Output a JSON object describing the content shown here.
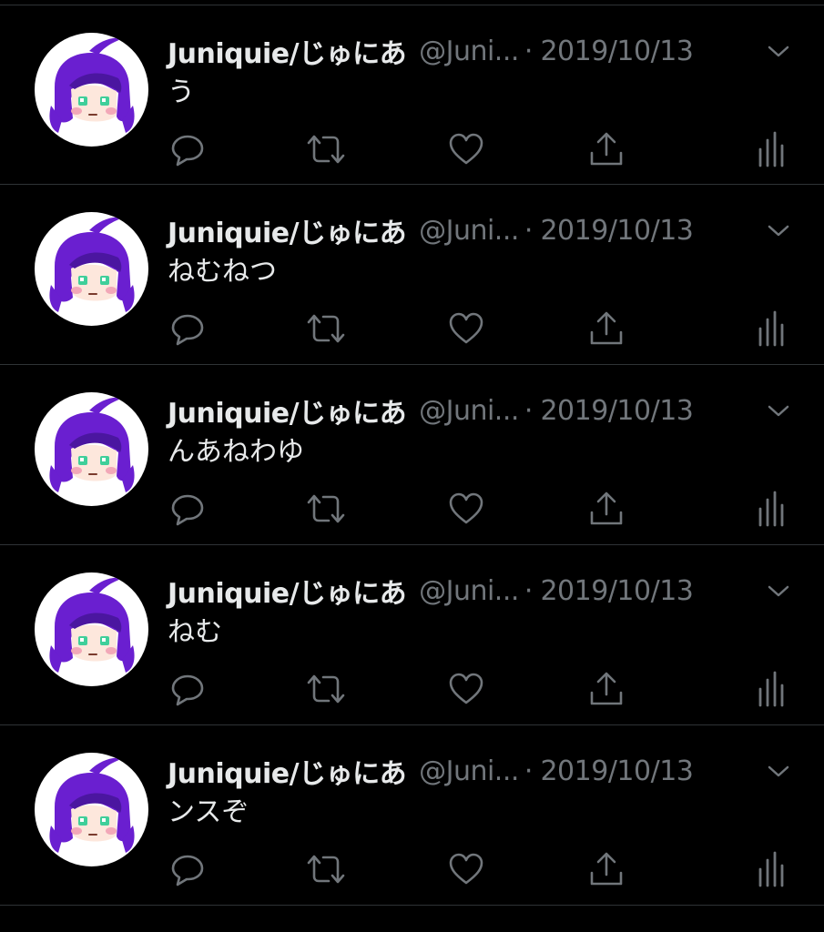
{
  "colors": {
    "background": "#000000",
    "text_primary": "#e7e9ea",
    "text_secondary": "#71767b",
    "divider": "#2f3336",
    "avatar_hair": "#6a1fd0",
    "avatar_eyes": "#3fcf9a"
  },
  "tweets": [
    {
      "display_name": "Juniquie/じゅにあ",
      "handle": "@Juni...",
      "separator": "·",
      "date": "2019/10/13",
      "text": "う",
      "avatar_icon": "purple-hair-girl-avatar",
      "menu_icon": "chevron-down-icon",
      "actions": [
        "reply-icon",
        "retweet-icon",
        "like-icon",
        "share-icon",
        "analytics-icon"
      ]
    },
    {
      "display_name": "Juniquie/じゅにあ",
      "handle": "@Juni...",
      "separator": "·",
      "date": "2019/10/13",
      "text": "ねむねつ",
      "avatar_icon": "purple-hair-girl-avatar",
      "menu_icon": "chevron-down-icon",
      "actions": [
        "reply-icon",
        "retweet-icon",
        "like-icon",
        "share-icon",
        "analytics-icon"
      ]
    },
    {
      "display_name": "Juniquie/じゅにあ",
      "handle": "@Juni...",
      "separator": "·",
      "date": "2019/10/13",
      "text": "んあねわゆ",
      "avatar_icon": "purple-hair-girl-avatar",
      "menu_icon": "chevron-down-icon",
      "actions": [
        "reply-icon",
        "retweet-icon",
        "like-icon",
        "share-icon",
        "analytics-icon"
      ]
    },
    {
      "display_name": "Juniquie/じゅにあ",
      "handle": "@Juni...",
      "separator": "·",
      "date": "2019/10/13",
      "text": "ねむ",
      "avatar_icon": "purple-hair-girl-avatar",
      "menu_icon": "chevron-down-icon",
      "actions": [
        "reply-icon",
        "retweet-icon",
        "like-icon",
        "share-icon",
        "analytics-icon"
      ]
    },
    {
      "display_name": "Juniquie/じゅにあ",
      "handle": "@Juni...",
      "separator": "·",
      "date": "2019/10/13",
      "text": "ンスぞ",
      "avatar_icon": "purple-hair-girl-avatar",
      "menu_icon": "chevron-down-icon",
      "actions": [
        "reply-icon",
        "retweet-icon",
        "like-icon",
        "share-icon",
        "analytics-icon"
      ]
    }
  ]
}
